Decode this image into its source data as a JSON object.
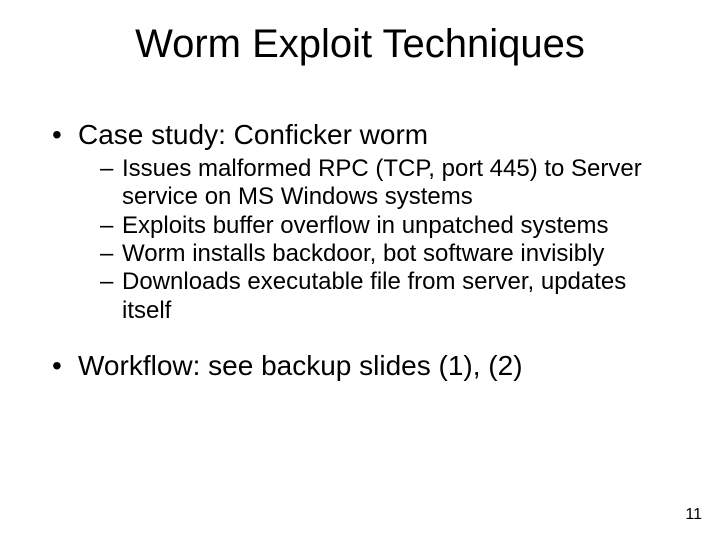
{
  "title": "Worm Exploit Techniques",
  "bullets": {
    "b1": "Case study: Conficker worm",
    "b1_subs": {
      "s1": "Issues malformed RPC (TCP, port 445) to Server service on MS Windows systems",
      "s2": "Exploits buffer overflow in unpatched systems",
      "s3": "Worm installs backdoor, bot software invisibly",
      "s4": "Downloads executable file from server, updates itself"
    },
    "b2": "Workflow: see backup slides (1), (2)"
  },
  "page_number": "11"
}
